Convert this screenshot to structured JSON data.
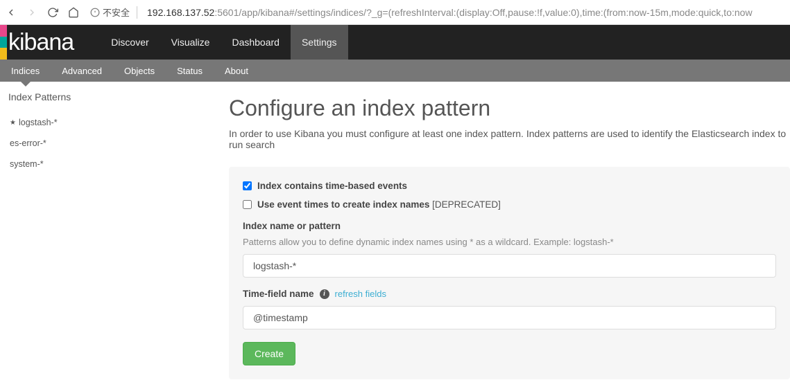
{
  "browser": {
    "security_label": "不安全",
    "url_host": "192.168.137.52",
    "url_port": ":5601",
    "url_path": "/app/kibana#/settings/indices/?_g=(refreshInterval:(display:Off,pause:!f,value:0),time:(from:now-15m,mode:quick,to:now"
  },
  "logo": "kibana",
  "topnav": {
    "items": [
      "Discover",
      "Visualize",
      "Dashboard",
      "Settings"
    ],
    "active_index": 3
  },
  "subnav": {
    "items": [
      "Indices",
      "Advanced",
      "Objects",
      "Status",
      "About"
    ],
    "active_index": 0
  },
  "sidebar": {
    "heading": "Index Patterns",
    "items": [
      {
        "label": "logstash-*",
        "default": true
      },
      {
        "label": "es-error-*",
        "default": false
      },
      {
        "label": "system-*",
        "default": false
      }
    ]
  },
  "page": {
    "title": "Configure an index pattern",
    "description": "In order to use Kibana you must configure at least one index pattern. Index patterns are used to identify the Elasticsearch index to run search"
  },
  "form": {
    "checkbox1": {
      "label": "Index contains time-based events",
      "checked": true
    },
    "checkbox2": {
      "label": "Use event times to create index names",
      "suffix": " [DEPRECATED]",
      "checked": false
    },
    "index_name": {
      "label": "Index name or pattern",
      "help": "Patterns allow you to define dynamic index names using * as a wildcard. Example: logstash-*",
      "value": "logstash-*"
    },
    "time_field": {
      "label": "Time-field name",
      "refresh_label": "refresh fields",
      "value": "@timestamp"
    },
    "create_button": "Create"
  }
}
